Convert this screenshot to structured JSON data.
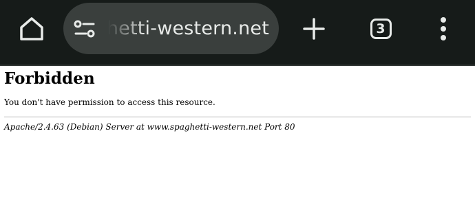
{
  "browser": {
    "url_display": "hetti-western.net",
    "tab_count": "3",
    "icons": {
      "home": "home-icon",
      "site_info": "site-settings-icon",
      "new_tab": "plus-icon",
      "tabs": "tab-switcher-icon",
      "menu": "more-vert-icon"
    },
    "colors": {
      "toolbar": "#161b19",
      "omnibox": "#3a3f3d",
      "icon": "#e8ebe9"
    }
  },
  "page": {
    "heading": "Forbidden",
    "message": "You don't have permission to access this resource.",
    "server_signature": "Apache/2.4.63 (Debian) Server at www.spaghetti-western.net Port 80"
  }
}
